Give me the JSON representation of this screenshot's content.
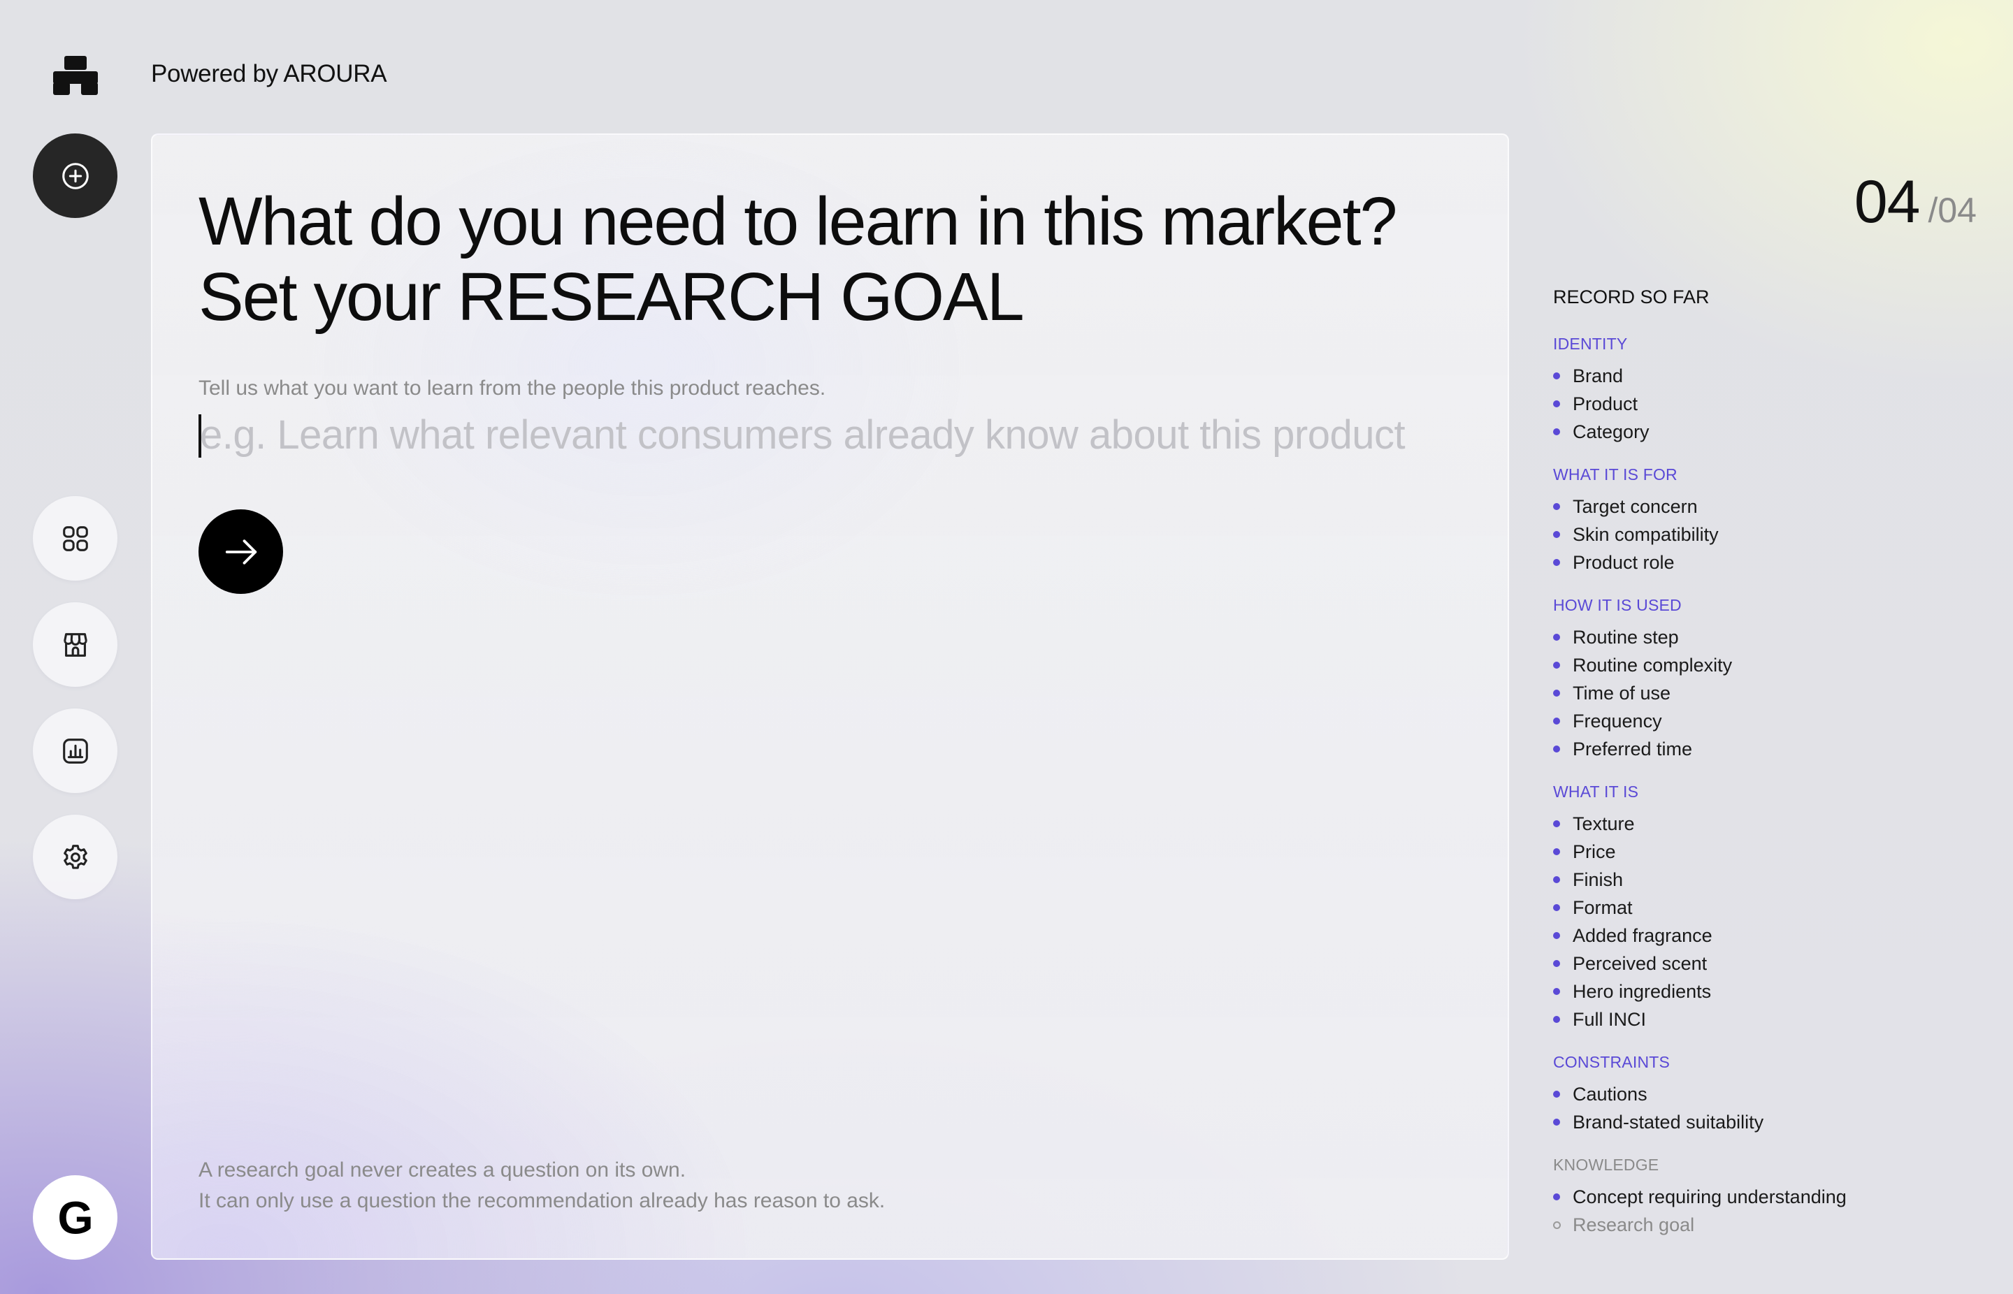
{
  "brand": {
    "powered_by": "Powered by AROURA"
  },
  "sidebar": {
    "new_button": "plus-circle-icon",
    "items": [
      "grid-icon",
      "store-icon",
      "chart-icon",
      "gear-icon"
    ],
    "account_initial": "G"
  },
  "main": {
    "headline_line1": "What do you need to learn in this market?",
    "headline_line2": "Set your RESEARCH GOAL",
    "prompt": "Tell us what you want to learn from the people this product reaches.",
    "input_value": "",
    "input_placeholder": "e.g. Learn what relevant consumers already know about this product",
    "submit_icon": "arrow-right-icon",
    "footnote_line1": "A research goal never creates a question on its own.",
    "footnote_line2": "It can only use a question the recommendation already has reason to ask."
  },
  "progress": {
    "current": "04",
    "total": "/04"
  },
  "record": {
    "title": "RECORD SO FAR",
    "sections": [
      {
        "label": "IDENTITY",
        "items": [
          "Brand",
          "Product",
          "Category"
        ]
      },
      {
        "label": "WHAT IT IS FOR",
        "items": [
          "Target concern",
          "Skin compatibility",
          "Product role"
        ]
      },
      {
        "label": "HOW IT IS USED",
        "items": [
          "Routine step",
          "Routine complexity",
          "Time of use",
          "Frequency",
          "Preferred time"
        ]
      },
      {
        "label": "WHAT IT IS",
        "items": [
          "Texture",
          "Price",
          "Finish",
          "Format",
          "Added fragrance",
          "Perceived scent",
          "Hero ingredients",
          "Full INCI"
        ]
      },
      {
        "label": "CONSTRAINTS",
        "items": [
          "Cautions",
          "Brand-stated suitability"
        ]
      },
      {
        "label": "KNOWLEDGE",
        "items": [
          "Concept requiring understanding",
          "Research goal"
        ]
      }
    ]
  },
  "colors": {
    "accent": "#5a49d6",
    "dark": "#262626",
    "muted": "#8a8a8a"
  }
}
